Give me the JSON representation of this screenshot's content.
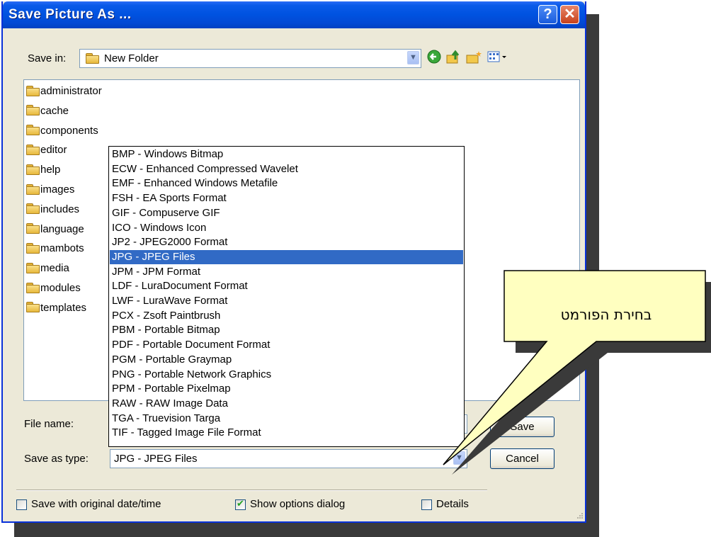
{
  "window": {
    "title": "Save Picture As ...",
    "help_glyph": "?",
    "close_glyph": "✕"
  },
  "save_in": {
    "label": "Save in:",
    "value": "New Folder"
  },
  "folders": [
    "administrator",
    "cache",
    "components",
    "editor",
    "help",
    "images",
    "includes",
    "language",
    "mambots",
    "media",
    "modules",
    "templates"
  ],
  "file_types": [
    "BMP - Windows Bitmap",
    "ECW - Enhanced Compressed Wavelet",
    "EMF - Enhanced Windows Metafile",
    "FSH - EA Sports Format",
    "GIF - Compuserve GIF",
    "ICO - Windows Icon",
    "JP2 - JPEG2000 Format",
    "JPG - JPEG Files",
    "JPM - JPM Format",
    "LDF - LuraDocument Format",
    "LWF - LuraWave Format",
    "PCX - Zsoft Paintbrush",
    "PBM - Portable Bitmap",
    "PDF - Portable Document Format",
    "PGM - Portable Graymap",
    "PNG - Portable Network Graphics",
    "PPM - Portable Pixelmap",
    "RAW - RAW Image Data",
    "TGA - Truevision Targa",
    "TIF - Tagged Image File Format"
  ],
  "selected_file_type": "JPG - JPEG Files",
  "file_name": {
    "label": "File name:"
  },
  "save_as_type": {
    "label": "Save as type:",
    "value": "JPG - JPEG Files"
  },
  "buttons": {
    "save": "Save",
    "cancel": "Cancel"
  },
  "options": {
    "original_date": {
      "label": "Save with original date/time",
      "checked": false
    },
    "show_options": {
      "label": "Show options dialog",
      "checked": true
    },
    "details": {
      "label": "Details",
      "checked": false
    }
  },
  "callout": {
    "text": "בחירת הפורמט",
    "fill": "#ffffc0"
  },
  "colors": {
    "title_bar": "#0052e0",
    "selection": "#316ac5",
    "dialog_bg": "#ece9d8"
  }
}
